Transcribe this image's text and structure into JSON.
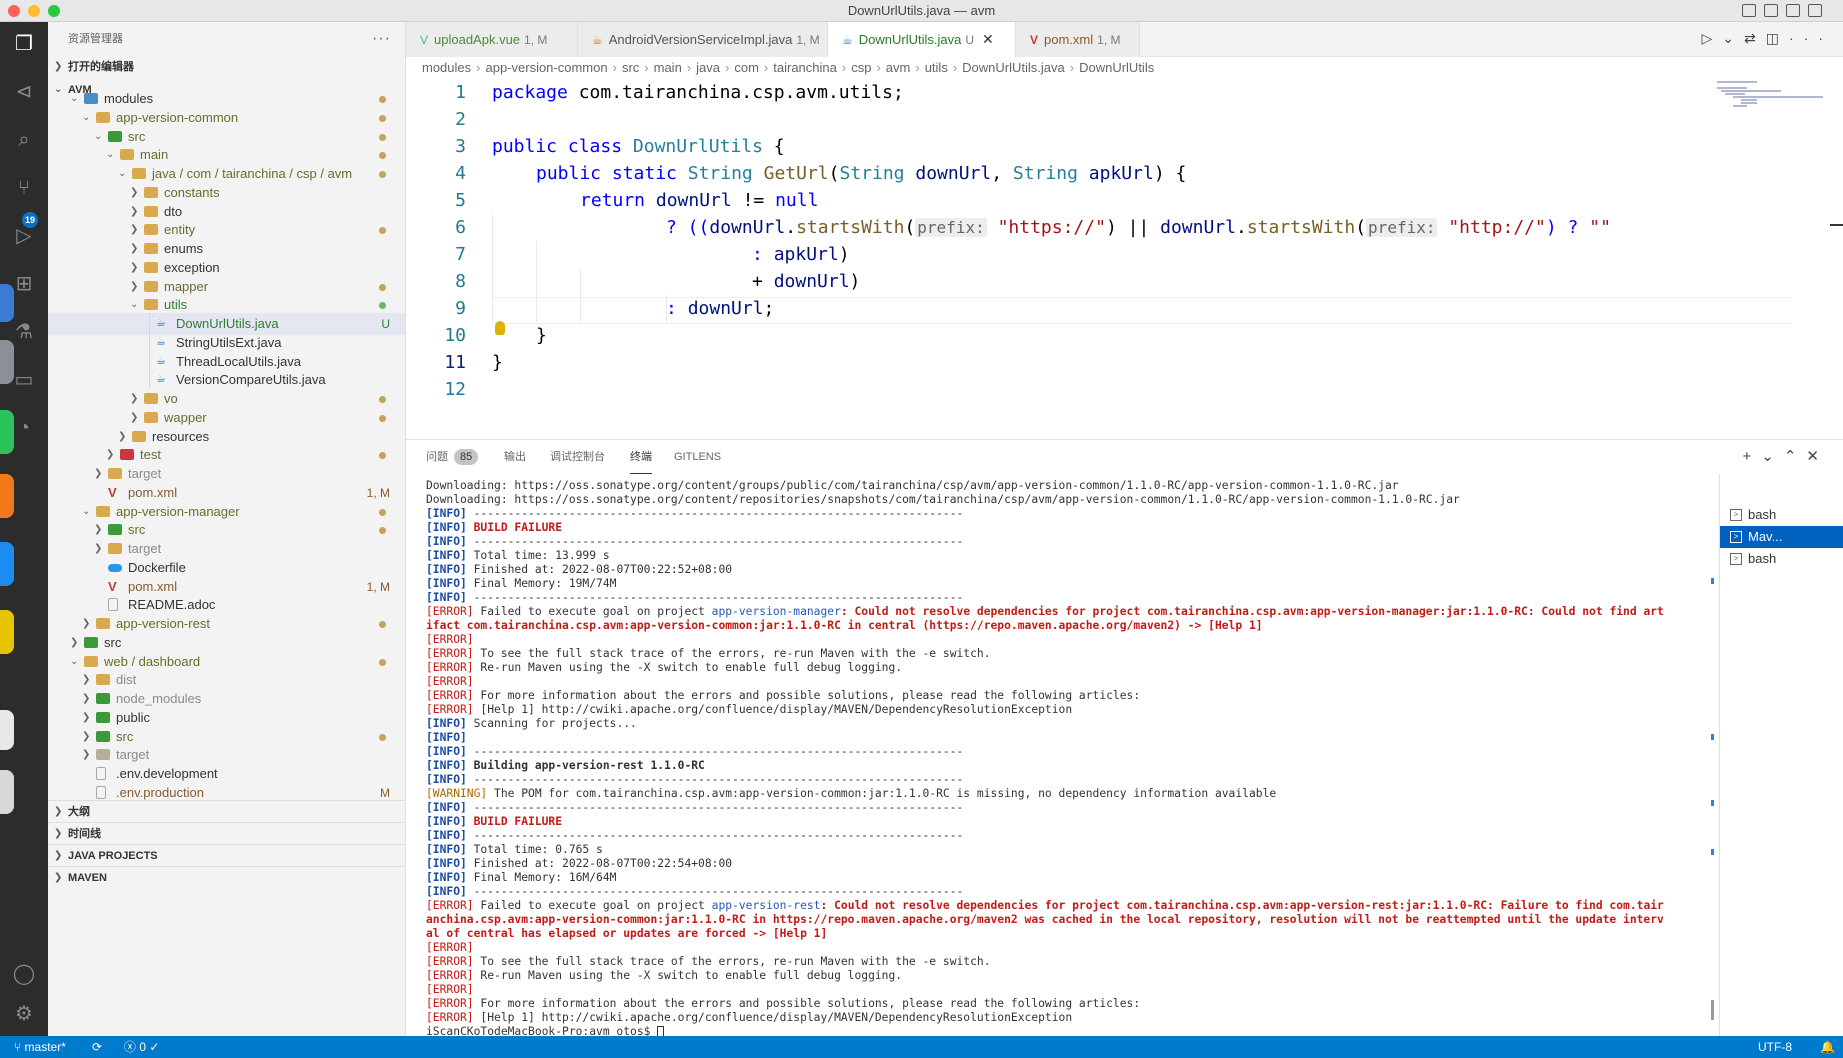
{
  "window": {
    "title": "DownUrlUtils.java — avm"
  },
  "sidebar": {
    "header": "资源管理器",
    "open_editors": "打开的编辑器",
    "root": "AVM",
    "tree": [
      {
        "label": "modules",
        "status": "dot"
      },
      {
        "label": "app-version-common",
        "status": "dot"
      },
      {
        "label": "src",
        "status": "dot"
      },
      {
        "label": "main",
        "status": "dot"
      },
      {
        "label": "java / com / tairanchina / csp / avm",
        "status": "dot"
      },
      {
        "label": "constants",
        "status": ""
      },
      {
        "label": "dto",
        "status": ""
      },
      {
        "label": "entity",
        "status": "dot"
      },
      {
        "label": "enums",
        "status": ""
      },
      {
        "label": "exception",
        "status": ""
      },
      {
        "label": "mapper",
        "status": "dot"
      },
      {
        "label": "utils",
        "status": "dot-green"
      },
      {
        "label": "DownUrlUtils.java",
        "status": "U"
      },
      {
        "label": "StringUtilsExt.java",
        "status": ""
      },
      {
        "label": "ThreadLocalUtils.java",
        "status": ""
      },
      {
        "label": "VersionCompareUtils.java",
        "status": ""
      },
      {
        "label": "vo",
        "status": "dot"
      },
      {
        "label": "wapper",
        "status": "dot"
      },
      {
        "label": "resources",
        "status": ""
      },
      {
        "label": "test",
        "status": "dot"
      },
      {
        "label": "target",
        "status": ""
      },
      {
        "label": "pom.xml",
        "status": "1, M"
      },
      {
        "label": "app-version-manager",
        "status": "dot"
      },
      {
        "label": "src",
        "status": "dot"
      },
      {
        "label": "target",
        "status": ""
      },
      {
        "label": "Dockerfile",
        "status": ""
      },
      {
        "label": "pom.xml",
        "status": "1, M"
      },
      {
        "label": "README.adoc",
        "status": ""
      },
      {
        "label": "app-version-rest",
        "status": "dot"
      },
      {
        "label": "src",
        "status": ""
      },
      {
        "label": "web / dashboard",
        "status": "dot"
      },
      {
        "label": "dist",
        "status": ""
      },
      {
        "label": "node_modules",
        "status": ""
      },
      {
        "label": "public",
        "status": ""
      },
      {
        "label": "src",
        "status": "dot"
      },
      {
        "label": "target",
        "status": ""
      },
      {
        "label": ".env.development",
        "status": ""
      },
      {
        "label": ".env.production",
        "status": "M"
      }
    ],
    "sections": [
      "大纲",
      "时间线",
      "JAVA PROJECTS",
      "MAVEN"
    ]
  },
  "activity_badge": "19",
  "tabs": [
    {
      "label": "uploadApk.vue",
      "mod": "1, M"
    },
    {
      "label": "AndroidVersionServiceImpl.java",
      "mod": "1, M"
    },
    {
      "label": "DownUrlUtils.java",
      "mod": "U"
    },
    {
      "label": "pom.xml",
      "mod": "1, M"
    }
  ],
  "breadcrumb": [
    "modules",
    "app-version-common",
    "src",
    "main",
    "java",
    "com",
    "tairanchina",
    "csp",
    "avm",
    "utils",
    "DownUrlUtils.java",
    "DownUrlUtils"
  ],
  "editor": {
    "line_numbers": [
      "1",
      "2",
      "3",
      "4",
      "5",
      "6",
      "7",
      "8",
      "9",
      "10",
      "11",
      "12"
    ],
    "l1_pkg": "package",
    "l1_name": " com.tairanchina.csp.avm.utils;",
    "l3_public": "public",
    "l3_class": "class",
    "l3_name": "DownUrlUtils",
    "l3_brace": " {",
    "l4_public": "public",
    "l4_static": "static",
    "l4_type": "String",
    "l4_fn": "GetUrl",
    "l4_p1t": "String",
    "l4_p1": "downUrl",
    "l4_p2t": "String",
    "l4_p2": "apkUrl",
    "l4_end": ") {",
    "l5_return": "return",
    "l5_var": "downUrl",
    "l5_op": " != ",
    "l5_null": "null",
    "l6_q": "? ((",
    "l6_var": "downUrl",
    "l6_fn": "startsWith",
    "l6_hint": "prefix:",
    "l6_s1": "\"https://\"",
    "l6_or": ") || ",
    "l6_var2": "downUrl",
    "l6_fn2": "startsWith",
    "l6_hint2": "prefix:",
    "l6_s2": "\"http://\"",
    "l6_end": ") ? ",
    "l6_s3": "\"\"",
    "l7_colon": ": ",
    "l7_var": "apkUrl",
    "l7_end": ")",
    "l8_plus": "+ ",
    "l8_var": "downUrl",
    "l8_end": ")",
    "l9_colon": ": ",
    "l9_var": "downUrl",
    "l9_end": ";",
    "l10": "}",
    "l11": "}"
  },
  "panel": {
    "tabs": [
      "问题",
      "输出",
      "调试控制台",
      "终端",
      "GITLENS"
    ],
    "problems_count": "85",
    "terminals": [
      "bash",
      "Mav...",
      "bash"
    ],
    "prompt": "iScanCKoTodeMacBook-Pro:avm otos$ ",
    "lines": [
      {
        "t": "plain",
        "text": "Downloading: https://oss.sonatype.org/content/groups/public/com/tairanchina/csp/avm/app-version-common/1.1.0-RC/app-version-common-1.1.0-RC.jar"
      },
      {
        "t": "plain",
        "text": "Downloading: https://oss.sonatype.org/content/repositories/snapshots/com/tairanchina/csp/avm/app-version-common/1.1.0-RC/app-version-common-1.1.0-RC.jar"
      },
      {
        "t": "info",
        "text": " ------------------------------------------------------------------------"
      },
      {
        "t": "info-fail",
        "text": " BUILD FAILURE"
      },
      {
        "t": "info",
        "text": " ------------------------------------------------------------------------"
      },
      {
        "t": "info",
        "text": " Total time: 13.999 s"
      },
      {
        "t": "info",
        "text": " Finished at: 2022-08-07T00:22:52+08:00"
      },
      {
        "t": "info",
        "text": " Final Memory: 19M/74M"
      },
      {
        "t": "info",
        "text": " ------------------------------------------------------------------------"
      },
      {
        "t": "error-goal",
        "text": " Failed to execute goal on project ",
        "proj": "app-version-manager",
        "msg": ": Could not resolve dependencies for project com.tairanchina.csp.avm:app-version-manager:jar:1.1.0-RC: Could not find art"
      },
      {
        "t": "red-bold",
        "text": "ifact com.tairanchina.csp.avm:app-version-common:jar:1.1.0-RC in central (https://repo.maven.apache.org/maven2) -> [Help 1]"
      },
      {
        "t": "error",
        "text": ""
      },
      {
        "t": "error",
        "text": " To see the full stack trace of the errors, re-run Maven with the -e switch."
      },
      {
        "t": "error",
        "text": " Re-run Maven using the -X switch to enable full debug logging."
      },
      {
        "t": "error",
        "text": ""
      },
      {
        "t": "error",
        "text": " For more information about the errors and possible solutions, please read the following articles:"
      },
      {
        "t": "error",
        "text": " [Help 1] http://cwiki.apache.org/confluence/display/MAVEN/DependencyResolutionException"
      },
      {
        "t": "info",
        "text": " Scanning for projects..."
      },
      {
        "t": "info",
        "text": ""
      },
      {
        "t": "info",
        "text": " ------------------------------------------------------------------------"
      },
      {
        "t": "info-bold",
        "text": " Building app-version-rest 1.1.0-RC"
      },
      {
        "t": "info",
        "text": " ------------------------------------------------------------------------"
      },
      {
        "t": "warn",
        "text": " The POM for com.tairanchina.csp.avm:app-version-common:jar:1.1.0-RC is missing, no dependency information available"
      },
      {
        "t": "info",
        "text": " ------------------------------------------------------------------------"
      },
      {
        "t": "info-fail",
        "text": " BUILD FAILURE"
      },
      {
        "t": "info",
        "text": " ------------------------------------------------------------------------"
      },
      {
        "t": "info",
        "text": " Total time: 0.765 s"
      },
      {
        "t": "info",
        "text": " Finished at: 2022-08-07T00:22:54+08:00"
      },
      {
        "t": "info",
        "text": " Final Memory: 16M/64M"
      },
      {
        "t": "info",
        "text": " ------------------------------------------------------------------------"
      },
      {
        "t": "error-goal",
        "text": " Failed to execute goal on project ",
        "proj": "app-version-rest",
        "msg": ": Could not resolve dependencies for project com.tairanchina.csp.avm:app-version-rest:jar:1.1.0-RC: Failure to find com.tair"
      },
      {
        "t": "red-bold",
        "text": "anchina.csp.avm:app-version-common:jar:1.1.0-RC in https://repo.maven.apache.org/maven2 was cached in the local repository, resolution will not be reattempted until the update interv"
      },
      {
        "t": "red-bold",
        "text": "al of central has elapsed or updates are forced -> [Help 1]"
      },
      {
        "t": "error",
        "text": ""
      },
      {
        "t": "error",
        "text": " To see the full stack trace of the errors, re-run Maven with the -e switch."
      },
      {
        "t": "error",
        "text": " Re-run Maven using the -X switch to enable full debug logging."
      },
      {
        "t": "error",
        "text": ""
      },
      {
        "t": "error",
        "text": " For more information about the errors and possible solutions, please read the following articles:"
      },
      {
        "t": "error",
        "text": " [Help 1] http://cwiki.apache.org/confluence/display/MAVEN/DependencyResolutionException"
      }
    ]
  },
  "statusbar": {
    "branch": "master*",
    "errors": "0",
    "encoding": "UTF-8"
  }
}
